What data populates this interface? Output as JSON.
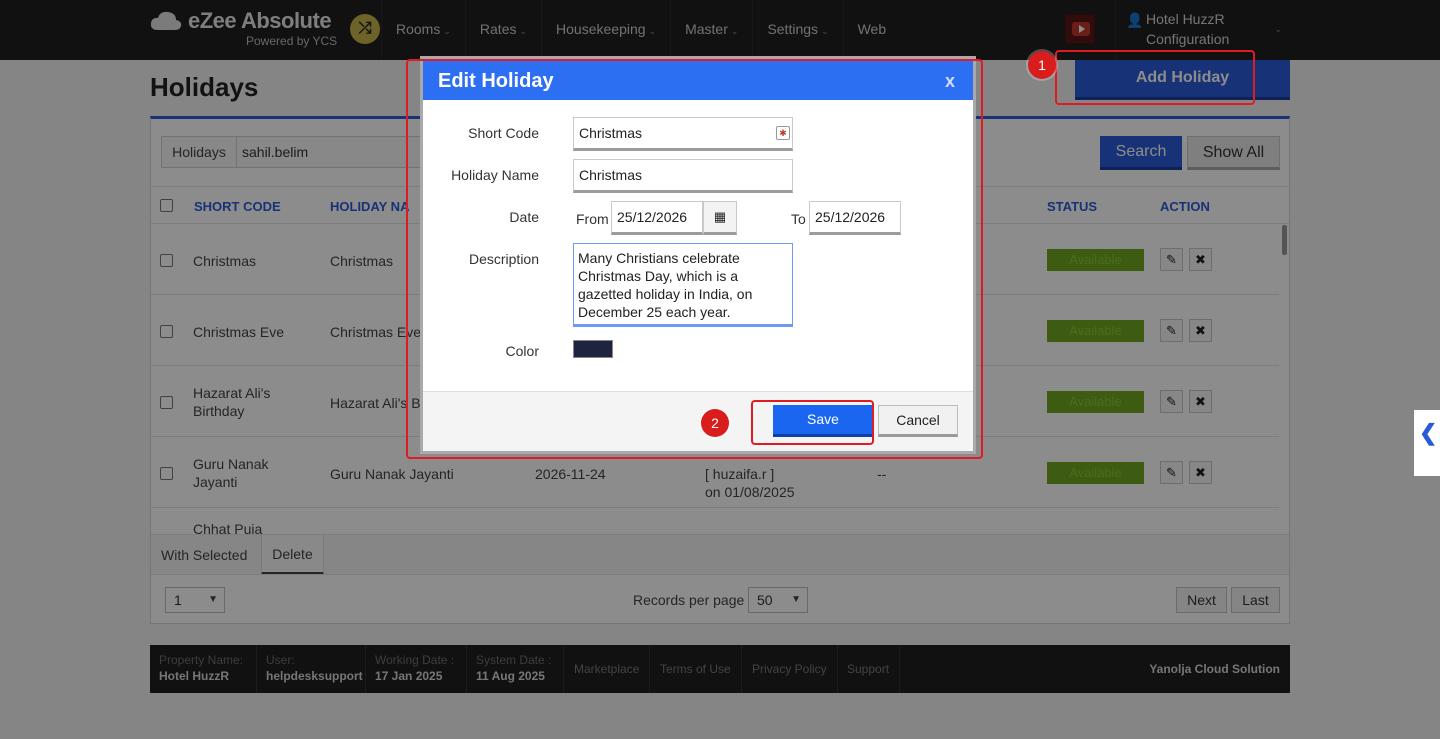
{
  "nav": {
    "brand": "eZee Absolute",
    "powered_by": "Powered by YCS",
    "items": [
      "Rooms",
      "Rates",
      "Housekeeping",
      "Master",
      "Settings",
      "Web"
    ],
    "hotel_name": "Hotel HuzzR",
    "hotel_sub": "Configuration"
  },
  "page": {
    "title": "Holidays",
    "add_button": "Add Holiday",
    "filter_label": "Holidays",
    "filter_value": "sahil.belim",
    "search_button": "Search",
    "show_all_button": "Show All"
  },
  "table": {
    "headers": [
      "SHORT CODE",
      "HOLIDAY NA",
      "STATUS",
      "ACTION"
    ],
    "rows": [
      {
        "code": "Christmas",
        "name": "Christmas",
        "status": "Available"
      },
      {
        "code": "Christmas Eve",
        "name": "Christmas Eve",
        "status": "Available"
      },
      {
        "code": "Hazarat Ali's Birthday",
        "name": "Hazarat Ali's B",
        "status": "Available"
      },
      {
        "code": "Guru Nanak Jayanti",
        "name": "Guru Nanak Jayanti",
        "date": "2026-11-24",
        "created_by": "[ huzaifa.r ]",
        "created_on": "on 01/08/2025",
        "other": "--",
        "status": "Available"
      },
      {
        "code": "Chhat Puja"
      }
    ]
  },
  "bottom": {
    "with_selected": "With Selected",
    "delete": "Delete",
    "page_value": "1",
    "records_per_page_label": "Records per page",
    "records_per_page_value": "50",
    "next": "Next",
    "last": "Last"
  },
  "footer": {
    "property_label": "Property Name:",
    "property_value": "Hotel HuzzR",
    "user_label": "User:",
    "user_value": "helpdesksupport",
    "working_label": "Working Date :",
    "working_value": "17 Jan 2025",
    "system_label": "System Date :",
    "system_value": "11 Aug 2025",
    "links": [
      "Marketplace",
      "Terms of Use",
      "Privacy Policy",
      "Support"
    ],
    "right": "Yanolja Cloud Solution"
  },
  "modal": {
    "title": "Edit Holiday",
    "close": "x",
    "short_code_label": "Short Code",
    "short_code_value": "Christmas",
    "holiday_name_label": "Holiday Name",
    "holiday_name_value": "Christmas",
    "date_label": "Date",
    "from_label": "From",
    "from_value": "25/12/2026",
    "to_label": "To",
    "to_value": "25/12/2026",
    "description_label": "Description",
    "description_value": "Many Christians celebrate Christmas Day, which is a gazetted holiday in India, on December 25 each year.",
    "color_label": "Color",
    "color_value": "#1e2440",
    "save": "Save",
    "cancel": "Cancel"
  },
  "annotations": {
    "marker1": "1",
    "marker2": "2"
  },
  "colors": {
    "accent": "#2a5bd7",
    "modal_header": "#2d6ff3",
    "status_available": "#6fa820",
    "highlight": "#e01b24"
  }
}
